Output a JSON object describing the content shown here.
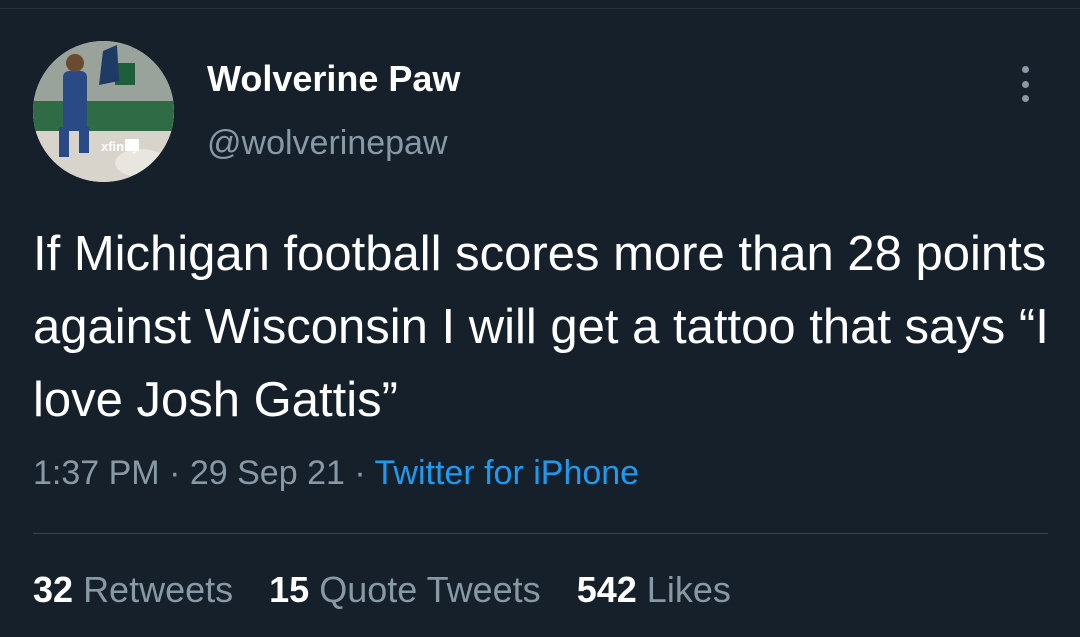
{
  "author": {
    "display_name": "Wolverine Paw",
    "handle": "@wolverinepaw",
    "avatar": "basketball-photo-avatar",
    "avatar_caption": "xfinity"
  },
  "tweet": {
    "text": "If Michigan football scores more than 28 points against Wisconsin I will get a tattoo that says “I love Josh Gattis”",
    "time": "1:37 PM",
    "date": "29 Sep 21",
    "separator": "·",
    "source": "Twitter for iPhone"
  },
  "stats": {
    "retweets_count": "32",
    "retweets_label": "Retweets",
    "quotes_count": "15",
    "quotes_label": "Quote Tweets",
    "likes_count": "542",
    "likes_label": "Likes"
  },
  "icons": {
    "more": "more-options-icon"
  },
  "colors": {
    "background": "#15202b",
    "primary_text": "#ffffff",
    "secondary_text": "#8899a6",
    "link": "#1d9bf0",
    "divider": "#38444d"
  }
}
